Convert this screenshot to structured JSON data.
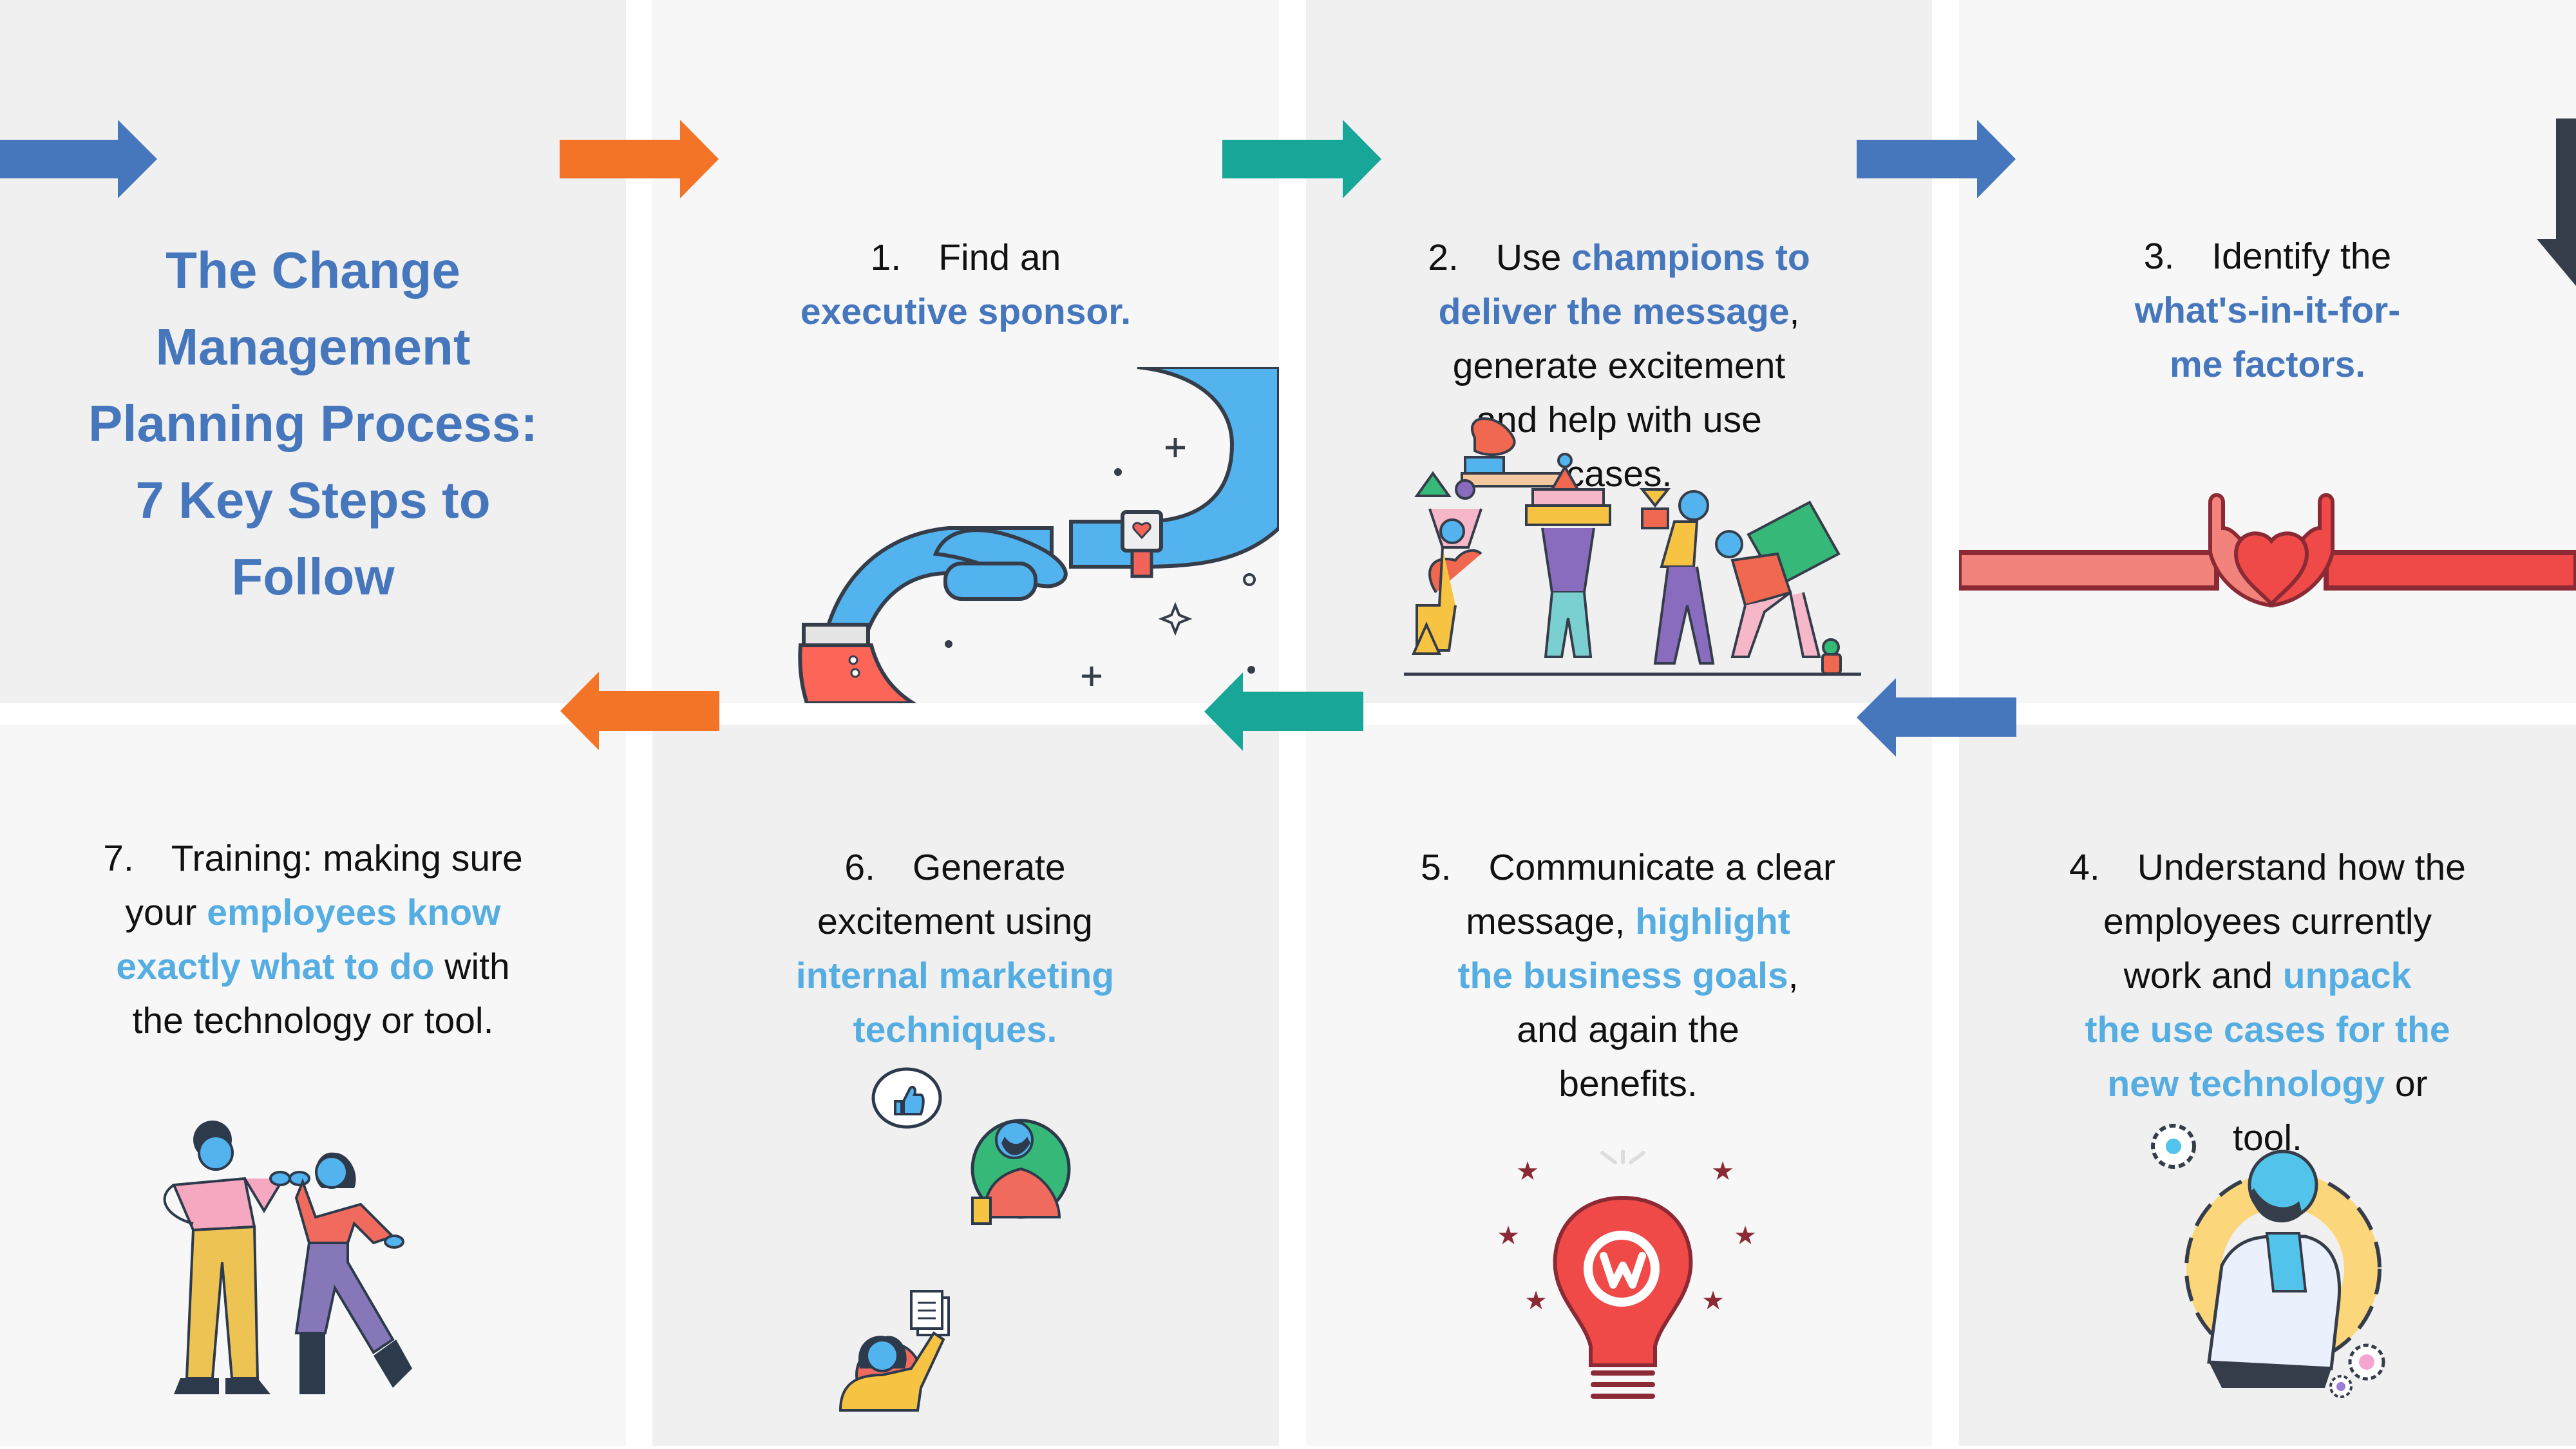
{
  "title": {
    "lines": [
      "The Change",
      "Management",
      "Planning Process:",
      "7 Key Steps to",
      "Follow"
    ]
  },
  "colors": {
    "blue": "#4677BD",
    "orange": "#F37327",
    "teal": "#17A697",
    "dark": "#363D4A",
    "highlight_top": "#4677BD",
    "highlight_bottom": "#55ADE2"
  },
  "steps": [
    {
      "number": "1.",
      "lines": [
        [
          {
            "t": "Find an",
            "h": false
          }
        ],
        [
          {
            "t": "executive sponsor.",
            "h": true
          }
        ]
      ],
      "illustration": "handshake-illustration"
    },
    {
      "number": "2.",
      "lines": [
        [
          {
            "t": "Use ",
            "h": false
          },
          {
            "t": "champions to",
            "h": true
          }
        ],
        [
          {
            "t": "deliver the message",
            "h": true
          },
          {
            "t": ",",
            "h": false
          }
        ],
        [
          {
            "t": "generate excitement",
            "h": false
          }
        ],
        [
          {
            "t": "and help with use",
            "h": false
          }
        ],
        [
          {
            "t": "cases.",
            "h": false
          }
        ]
      ],
      "illustration": "team-carrying-blocks-illustration"
    },
    {
      "number": "3.",
      "lines": [
        [
          {
            "t": "Identify the",
            "h": false
          }
        ],
        [
          {
            "t": "what's-in-it-for-",
            "h": true
          }
        ],
        [
          {
            "t": "me factors.",
            "h": true
          }
        ]
      ],
      "illustration": "heart-hands-illustration"
    },
    {
      "number": "4.",
      "lines": [
        [
          {
            "t": "Understand how the",
            "h": false
          }
        ],
        [
          {
            "t": "employees currently",
            "h": false
          }
        ],
        [
          {
            "t": "work and ",
            "h": false
          },
          {
            "t": "unpack",
            "h": true
          }
        ],
        [
          {
            "t": "the use cases for the",
            "h": true
          }
        ],
        [
          {
            "t": "new technology",
            "h": true
          },
          {
            "t": " or",
            "h": false
          }
        ],
        [
          {
            "t": "tool.",
            "h": false
          }
        ]
      ],
      "illustration": "thinking-person-gears-illustration"
    },
    {
      "number": "5.",
      "lines": [
        [
          {
            "t": "Communicate a clear",
            "h": false
          }
        ],
        [
          {
            "t": "message, ",
            "h": false
          },
          {
            "t": "highlight",
            "h": true
          }
        ],
        [
          {
            "t": "the business goals",
            "h": true
          },
          {
            "t": ",",
            "h": false
          }
        ],
        [
          {
            "t": "and again the",
            "h": false
          }
        ],
        [
          {
            "t": "benefits.",
            "h": false
          }
        ]
      ],
      "illustration": "lightbulb-workplace-illustration"
    },
    {
      "number": "6.",
      "lines": [
        [
          {
            "t": "Generate",
            "h": false
          }
        ],
        [
          {
            "t": "excitement using",
            "h": false
          }
        ],
        [
          {
            "t": "internal marketing",
            "h": true
          }
        ],
        [
          {
            "t": "techniques.",
            "h": true
          }
        ]
      ],
      "illustration": "people-sharing-illustration"
    },
    {
      "number": "7.",
      "lines": [
        [
          {
            "t": "Training: making sure",
            "h": false
          }
        ],
        [
          {
            "t": "your ",
            "h": false
          },
          {
            "t": "employees know",
            "h": true
          }
        ],
        [
          {
            "t": "exactly what to do",
            "h": true
          },
          {
            "t": " with",
            "h": false
          }
        ],
        [
          {
            "t": "the technology or tool.",
            "h": false
          }
        ]
      ],
      "illustration": "fist-bump-illustration"
    }
  ]
}
